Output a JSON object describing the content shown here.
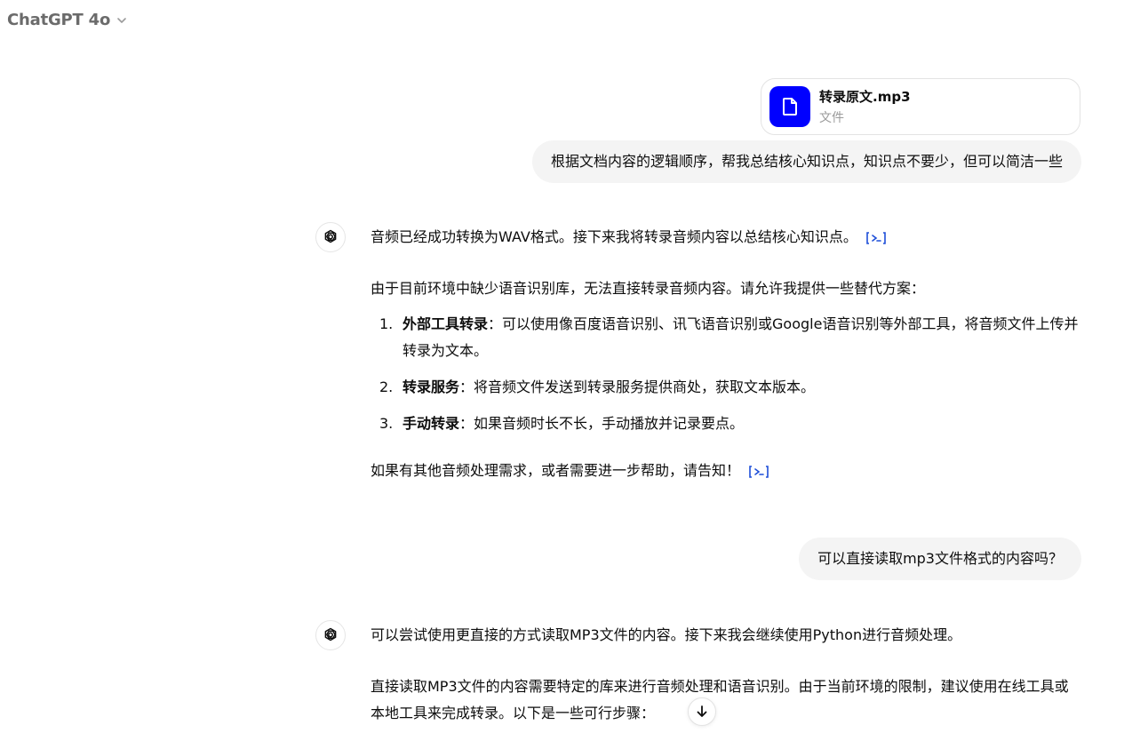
{
  "header": {
    "model_name": "ChatGPT 4o"
  },
  "conversation": {
    "file": {
      "name": "转录原文.mp3",
      "type": "文件"
    },
    "user_message_1": "根据文档内容的逻辑顺序，帮我总结核心知识点，知识点不要少，但可以简洁一些",
    "assistant_message_1": {
      "intro": "音频已经成功转换为WAV格式。接下来我将转录音频内容以总结核心知识点。",
      "para": "由于目前环境中缺少语音识别库，无法直接转录音频内容。请允许我提供一些替代方案：",
      "items": [
        {
          "num": "1.",
          "title": "外部工具转录",
          "text": "：可以使用像百度语音识别、讯飞语音识别或Google语音识别等外部工具，将音频文件上传并转录为文本。"
        },
        {
          "num": "2.",
          "title": "转录服务",
          "text": "：将音频文件发送到转录服务提供商处，获取文本版本。"
        },
        {
          "num": "3.",
          "title": "手动转录",
          "text": "：如果音频时长不长，手动播放并记录要点。"
        }
      ],
      "outro": "如果有其他音频处理需求，或者需要进一步帮助，请告知！"
    },
    "user_message_2": "可以直接读取mp3文件格式的内容吗？",
    "assistant_message_2": {
      "intro": "可以尝试使用更直接的方式读取MP3文件的内容。接下来我会继续使用Python进行音频处理。",
      "para": "直接读取MP3文件的内容需要特定的库来进行音频处理和语音识别。由于当前环境的限制，建议使用在线工具或本地工具来完成转录。以下是一些可行步骤："
    }
  },
  "colors": {
    "file_icon_bg": "#0000ff",
    "user_bubble_bg": "#f4f4f4",
    "ref_icon": "#1d4ed8"
  },
  "icons": {
    "model_dropdown": "chevron-down-icon",
    "file": "document-icon",
    "assistant": "openai-logo-icon",
    "reference": "code-reference-icon",
    "scroll": "arrow-down-icon"
  }
}
